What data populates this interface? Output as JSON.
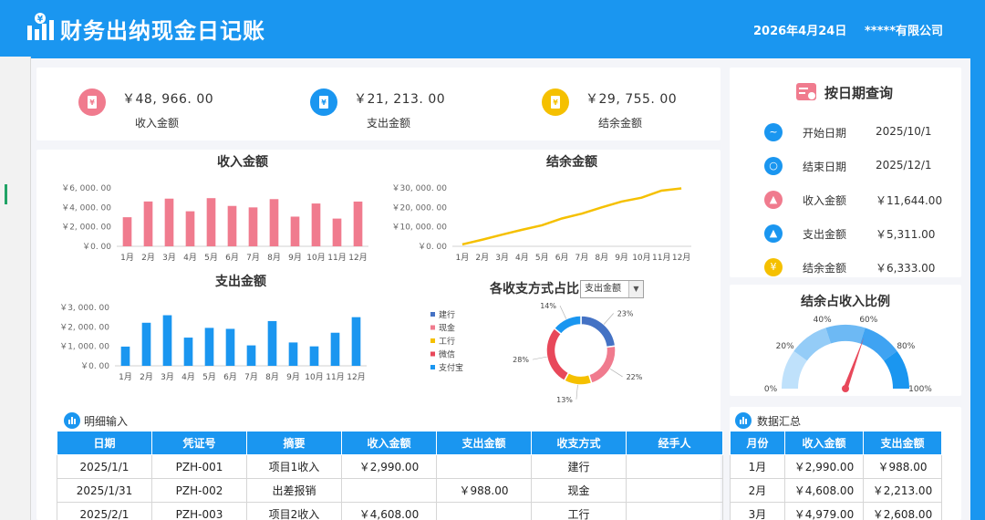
{
  "header": {
    "title": "财务出纳现金日记账",
    "date": "2026年4月24日",
    "company": "*****有限公司",
    "logo_icon": "bar-chart-icon"
  },
  "kpis": [
    {
      "value": "￥48, 966. 00",
      "label": "收入金额",
      "color": "#f07b8e",
      "icon": "receipt-icon"
    },
    {
      "value": "￥21, 213. 00",
      "label": "支出金额",
      "color": "#1a96f0",
      "icon": "yen-icon"
    },
    {
      "value": "￥29, 755. 00",
      "label": "结余金额",
      "color": "#f5c000",
      "icon": "wallet-icon"
    }
  ],
  "query": {
    "title": "按日期查询",
    "rows": [
      {
        "label": "开始日期",
        "value": "2025/10/1",
        "color": "#1a96f0",
        "icon": "trend-icon",
        "glyph": "~"
      },
      {
        "label": "结束日期",
        "value": "2025/12/1",
        "color": "#1a96f0",
        "icon": "search-icon",
        "glyph": "○"
      },
      {
        "label": "收入金额",
        "value": "￥11,644.00",
        "color": "#f07b8e",
        "icon": "chart-icon",
        "glyph": "▲"
      },
      {
        "label": "支出金额",
        "value": "￥5,311.00",
        "color": "#1a96f0",
        "icon": "chart-icon",
        "glyph": "▲"
      },
      {
        "label": "结余金额",
        "value": "￥6,333.00",
        "color": "#f5c000",
        "icon": "yen-icon",
        "glyph": "¥"
      }
    ]
  },
  "chart_data": [
    {
      "type": "bar",
      "title": "收入金额",
      "categories": [
        "1月",
        "2月",
        "3月",
        "4月",
        "5月",
        "6月",
        "7月",
        "8月",
        "9月",
        "10月",
        "11月",
        "12月"
      ],
      "values": [
        2990,
        4608,
        4900,
        3600,
        4950,
        4150,
        4000,
        4850,
        3050,
        4400,
        2850,
        4600
      ],
      "ylim": [
        0,
        6000
      ],
      "yticks": [
        "￥0. 00",
        "￥2, 000. 00",
        "￥4, 000. 00",
        "￥6, 000. 00"
      ],
      "color": "#f07b8e"
    },
    {
      "type": "line",
      "title": "结余金额",
      "categories": [
        "1月",
        "2月",
        "3月",
        "4月",
        "5月",
        "6月",
        "7月",
        "8月",
        "9月",
        "10月",
        "11月",
        "12月"
      ],
      "values": [
        1000,
        3400,
        6000,
        8500,
        10800,
        14300,
        16800,
        20000,
        23000,
        25000,
        28600,
        29755
      ],
      "ylim": [
        0,
        30000
      ],
      "yticks": [
        "￥0. 00",
        "￥10, 000. 00",
        "￥20, 000. 00",
        "￥30, 000. 00"
      ],
      "color": "#f5c000"
    },
    {
      "type": "bar",
      "title": "支出金额",
      "categories": [
        "1月",
        "2月",
        "3月",
        "4月",
        "5月",
        "6月",
        "7月",
        "8月",
        "9月",
        "10月",
        "11月",
        "12月"
      ],
      "values": [
        988,
        2213,
        2600,
        1450,
        1950,
        1900,
        1050,
        2300,
        1200,
        1000,
        1700,
        2500
      ],
      "ylim": [
        0,
        3000
      ],
      "yticks": [
        "￥0. 00",
        "￥1, 000. 00",
        "￥2, 000. 00",
        "￥3, 000. 00"
      ],
      "color": "#1a96f0"
    },
    {
      "type": "pie",
      "title": "各收支方式占比",
      "selector": "支出金额",
      "series": [
        {
          "name": "建行",
          "value": 23,
          "label": "23%",
          "color": "#4472c4"
        },
        {
          "name": "现金",
          "value": 22,
          "label": "22%",
          "color": "#f07b8e"
        },
        {
          "name": "工行",
          "value": 13,
          "label": "13%",
          "color": "#f5c000"
        },
        {
          "name": "微信",
          "value": 28,
          "label": "28%",
          "color": "#e8485a"
        },
        {
          "name": "支付宝",
          "value": 14,
          "label": "14%",
          "color": "#1a96f0"
        }
      ]
    }
  ],
  "gauge": {
    "title": "结余占收入比例",
    "value": 0.61,
    "ticks": [
      "0%",
      "20%",
      "40%",
      "60%",
      "80%",
      "100%"
    ]
  },
  "detail": {
    "title": "明细输入",
    "headers": [
      "日期",
      "凭证号",
      "摘要",
      "收入金额",
      "支出金额",
      "收支方式",
      "经手人"
    ],
    "rows": [
      [
        "2025/1/1",
        "PZH-001",
        "项目1收入",
        "￥2,990.00",
        "",
        "建行",
        ""
      ],
      [
        "2025/1/31",
        "PZH-002",
        "出差报销",
        "",
        "￥988.00",
        "现金",
        ""
      ],
      [
        "2025/2/1",
        "PZH-003",
        "项目2收入",
        "￥4,608.00",
        "",
        "工行",
        ""
      ]
    ]
  },
  "summary": {
    "title": "数据汇总",
    "headers": [
      "月份",
      "收入金额",
      "支出金额"
    ],
    "rows": [
      [
        "1月",
        "￥2,990.00",
        "￥988.00"
      ],
      [
        "2月",
        "￥4,608.00",
        "￥2,213.00"
      ],
      [
        "3月",
        "￥4,979.00",
        "￥2,608.00"
      ]
    ]
  }
}
